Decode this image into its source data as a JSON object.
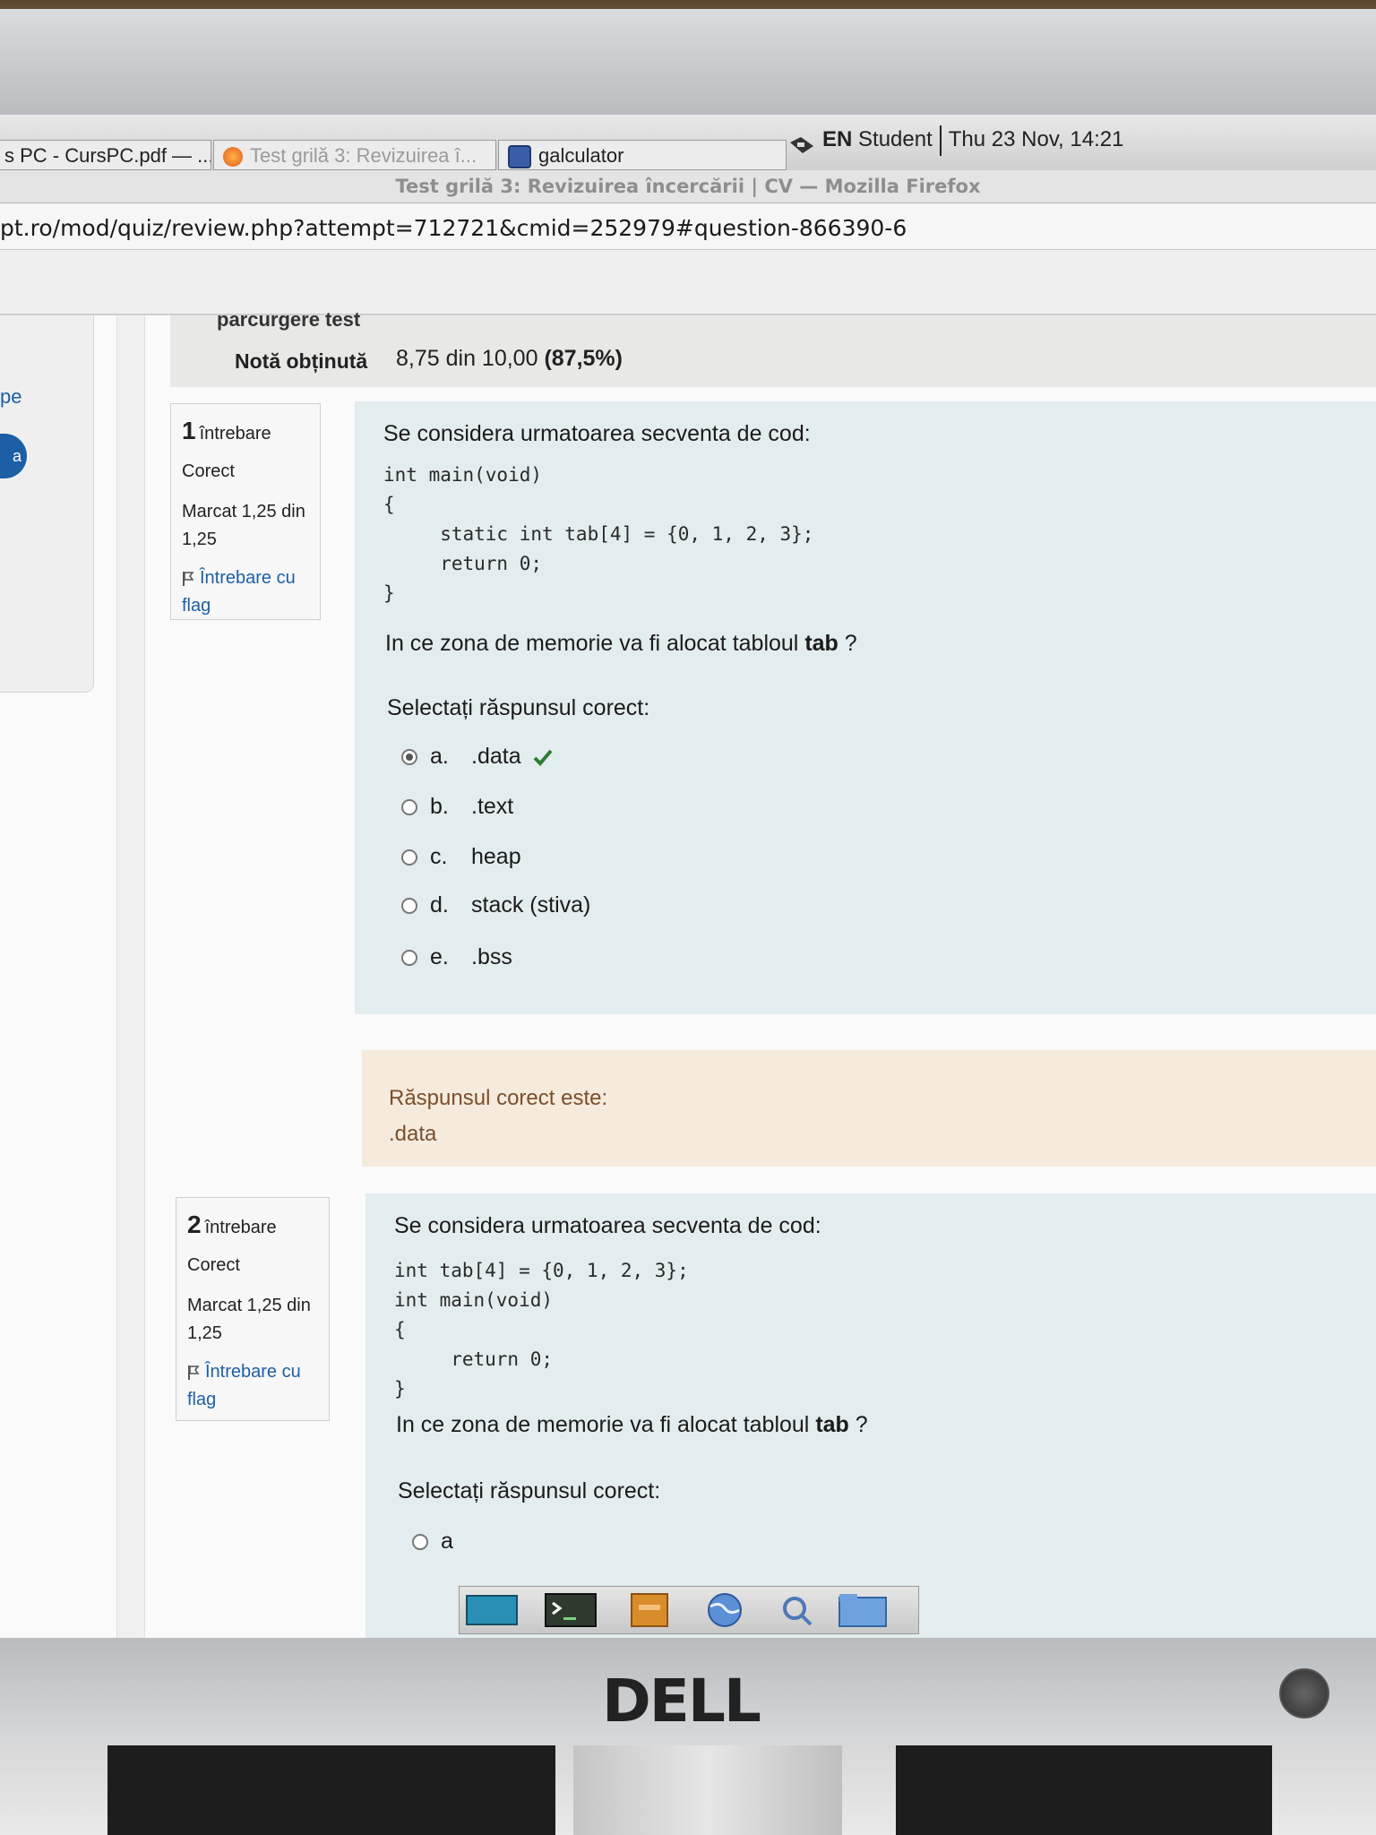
{
  "taskbar": {
    "tasks": [
      {
        "label": "s PC - CursPC.pdf — ...",
        "state": "inactive-window"
      },
      {
        "label": "Test grilă 3: Revizuirea î...",
        "state": "inactive-window"
      },
      {
        "label": "galculator",
        "state": "active-window"
      }
    ],
    "tray_lang": "EN",
    "tray_user": "Student",
    "tray_clock": "Thu 23 Nov, 14:21"
  },
  "window": {
    "title": "Test grilă 3: Revizuirea încercării | CV — Mozilla Firefox"
  },
  "address_bar": {
    "url": "pt.ro/mod/quiz/review.php?attempt=712721&cmid=252979#question-866390-6"
  },
  "drawer": {
    "link_fragment": "pe",
    "button_fragment": "a"
  },
  "summary": {
    "cut_label": "parcurgere test",
    "grade_label": "Notă obținută",
    "grade_value_prefix": "8,75",
    "grade_value_rest": " din 10,00 ",
    "grade_percent": "(87,5%)"
  },
  "questions": [
    {
      "number": "1",
      "number_label": "întrebare",
      "state": "Corect",
      "mark_line1": "Marcat 1,25 din",
      "mark_line2": "1,25",
      "flag_line1": "Întrebare cu",
      "flag_line2": "flag",
      "text": "Se considera urmatoarea secventa de cod:",
      "code": "int main(void)\n{\n     static int tab[4] = {0, 1, 2, 3};\n     return 0;\n}",
      "ask_prefix": "In ce zona de memorie va fi alocat tabloul ",
      "ask_bold": "tab",
      "ask_suffix": " ?",
      "prompt": "Selectați răspunsul corect:",
      "answers": [
        {
          "letter": "a.",
          "text": ".data",
          "checked": true,
          "correct": true
        },
        {
          "letter": "b.",
          "text": ".text",
          "checked": false
        },
        {
          "letter": "c.",
          "text": "heap",
          "checked": false
        },
        {
          "letter": "d.",
          "text": "stack (stiva)",
          "checked": false
        },
        {
          "letter": "e.",
          "text": ".bss",
          "checked": false
        }
      ],
      "right_answer_label": "Răspunsul corect este:",
      "right_answer_value": ".data"
    },
    {
      "number": "2",
      "number_label": "întrebare",
      "state": "Corect",
      "mark_line1": "Marcat 1,25 din",
      "mark_line2": "1,25",
      "flag_line1": "Întrebare cu",
      "flag_line2": "flag",
      "text": "Se considera urmatoarea secventa de cod:",
      "code": "int tab[4] = {0, 1, 2, 3};\nint main(void)\n{\n     return 0;\n}",
      "ask_prefix": "In ce zona de memorie va fi alocat tabloul ",
      "ask_bold": "tab",
      "ask_suffix": " ?",
      "prompt": "Selectați răspunsul corect:",
      "answers": [
        {
          "letter": "a",
          "text": "",
          "checked": false
        }
      ]
    }
  ],
  "dock": {
    "items": [
      "desktop-icon",
      "terminal-icon",
      "file-manager-icon",
      "browser-globe-icon",
      "search-icon",
      "folder-icon"
    ]
  },
  "monitor": {
    "brand": "DELL"
  },
  "colors": {
    "link": "#1d5fa6",
    "formulation_bg": "#e3ecee",
    "outcome_bg": "#f5eadc",
    "correct_check": "#2e7d32"
  }
}
